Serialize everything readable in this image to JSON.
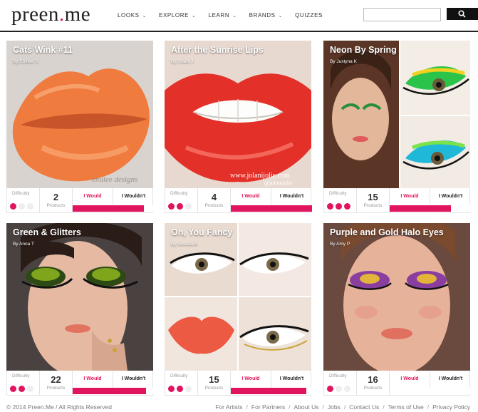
{
  "header": {
    "logo_main": "preen",
    "logo_dot": ".",
    "logo_tld": "me",
    "nav": [
      {
        "label": "LOOKS"
      },
      {
        "label": "EXPLORE"
      },
      {
        "label": "LEARN"
      },
      {
        "label": "BRANDS"
      },
      {
        "label": "QUIZZES"
      }
    ],
    "search_placeholder": ""
  },
  "labels": {
    "difficulty": "Difficulty",
    "products": "Products",
    "would": "I Would",
    "wouldnt": "I Wouldn't"
  },
  "cards": [
    {
      "title": "Cats Wink #11",
      "by": "By Emilee S",
      "difficulty": 1,
      "products": "2",
      "would_share": 0.88
    },
    {
      "title": "After the Sunrise Lips",
      "by": "By Jolani J",
      "difficulty": 2,
      "products": "4",
      "would_share": 1.0
    },
    {
      "title": "Neon By Spring",
      "by": "By Justyna K",
      "difficulty": 3,
      "products": "15",
      "would_share": 0.75
    },
    {
      "title": "Green & Glitters",
      "by": "By Anna T",
      "difficulty": 2,
      "products": "22",
      "would_share": 0.9
    },
    {
      "title": "Oh, You Fancy",
      "by": "By Jessica B",
      "difficulty": 2,
      "products": "15",
      "would_share": 0.93
    },
    {
      "title": "Purple and Gold Halo Eyes",
      "by": "By Amy P",
      "difficulty": 1,
      "products": "16",
      "would_share": 0.0
    }
  ],
  "footer": {
    "copyright": "© 2014 Preen.Me / All Rights Reserved",
    "links": [
      "For Artists",
      "For Partners",
      "About Us",
      "Jobs",
      "Contact Us",
      "Terms of Use",
      "Privacy Policy"
    ]
  },
  "colors": {
    "accent": "#e0145f",
    "header_rule": "#222222"
  }
}
